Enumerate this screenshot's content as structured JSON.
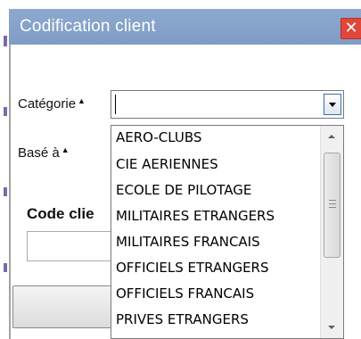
{
  "window": {
    "title": "Codification client",
    "close_glyph": "✕"
  },
  "form": {
    "categorie_label": "Catégorie",
    "base_label": "Basé à",
    "code_label": "Code clie",
    "required_marker": "▲",
    "categorie_value": ""
  },
  "dropdown": {
    "items": [
      "AERO-CLUBS",
      "CIE AERIENNES",
      "ECOLE DE PILOTAGE",
      "MILITAIRES ETRANGERS",
      "MILITAIRES FRANCAIS",
      "OFFICIELS ETRANGERS",
      "OFFICIELS FRANCAIS",
      "PRIVES ETRANGERS"
    ]
  },
  "icons": {
    "close": "close-icon",
    "dropdown": "chevron-down-icon",
    "scroll_up": "arrow-up-icon",
    "scroll_down": "arrow-down-icon"
  },
  "colors": {
    "titlebar": "#8da9cf",
    "close": "#e0463a"
  }
}
